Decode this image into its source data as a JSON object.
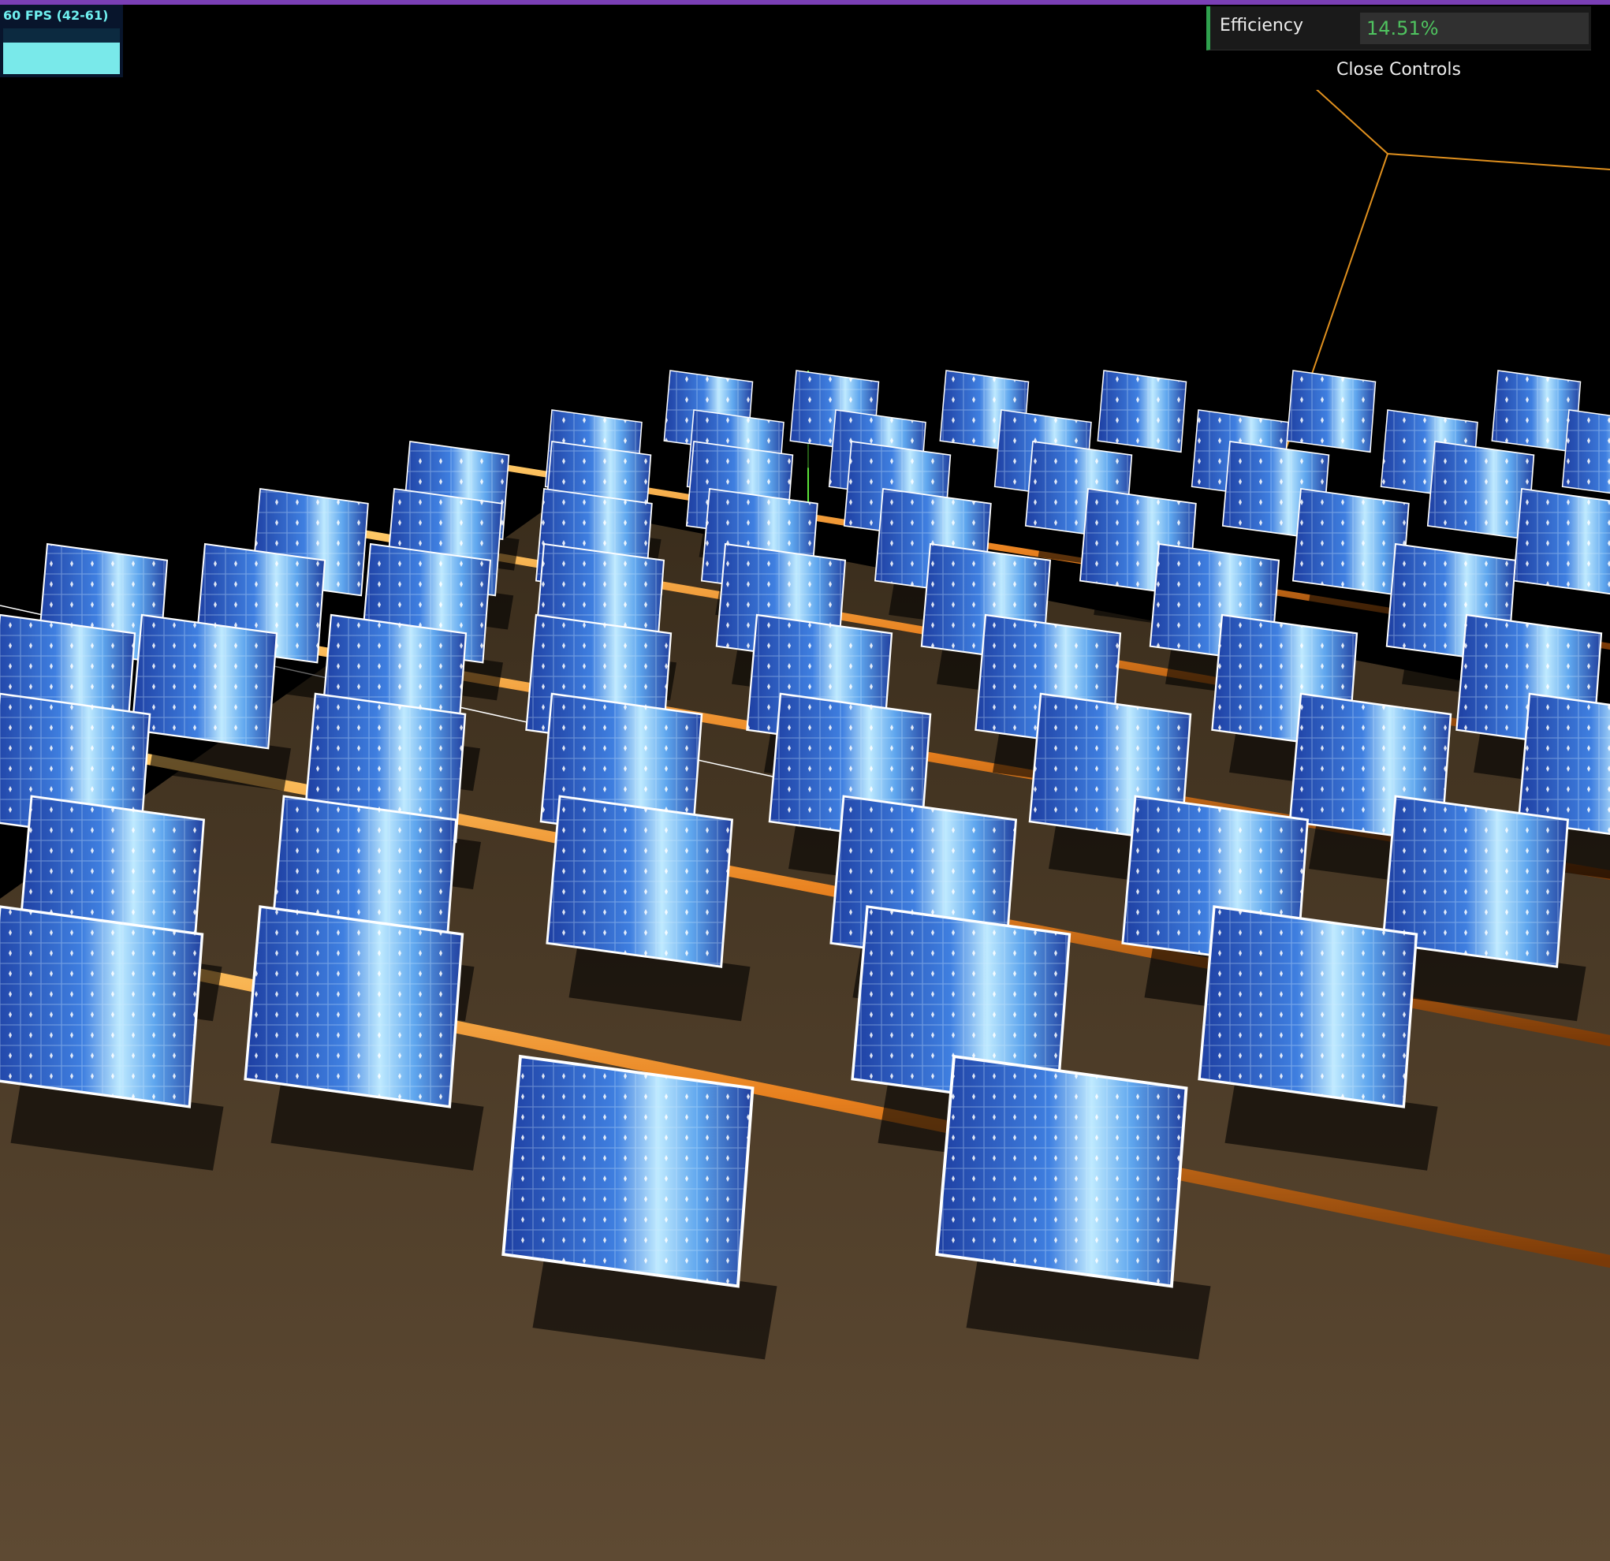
{
  "stats": {
    "fps_text": "60 FPS (42-61)"
  },
  "gui": {
    "efficiency_label": "Efficiency",
    "efficiency_value": "14.51%",
    "close_label": "Close Controls"
  },
  "colors": {
    "accent": "#7a3fb5",
    "gui_value": "#4fc35f",
    "stats_text": "#6ff0f0",
    "tube": "#e8801e",
    "helper_line": "#e0901e",
    "axis_green": "#5be33a"
  }
}
